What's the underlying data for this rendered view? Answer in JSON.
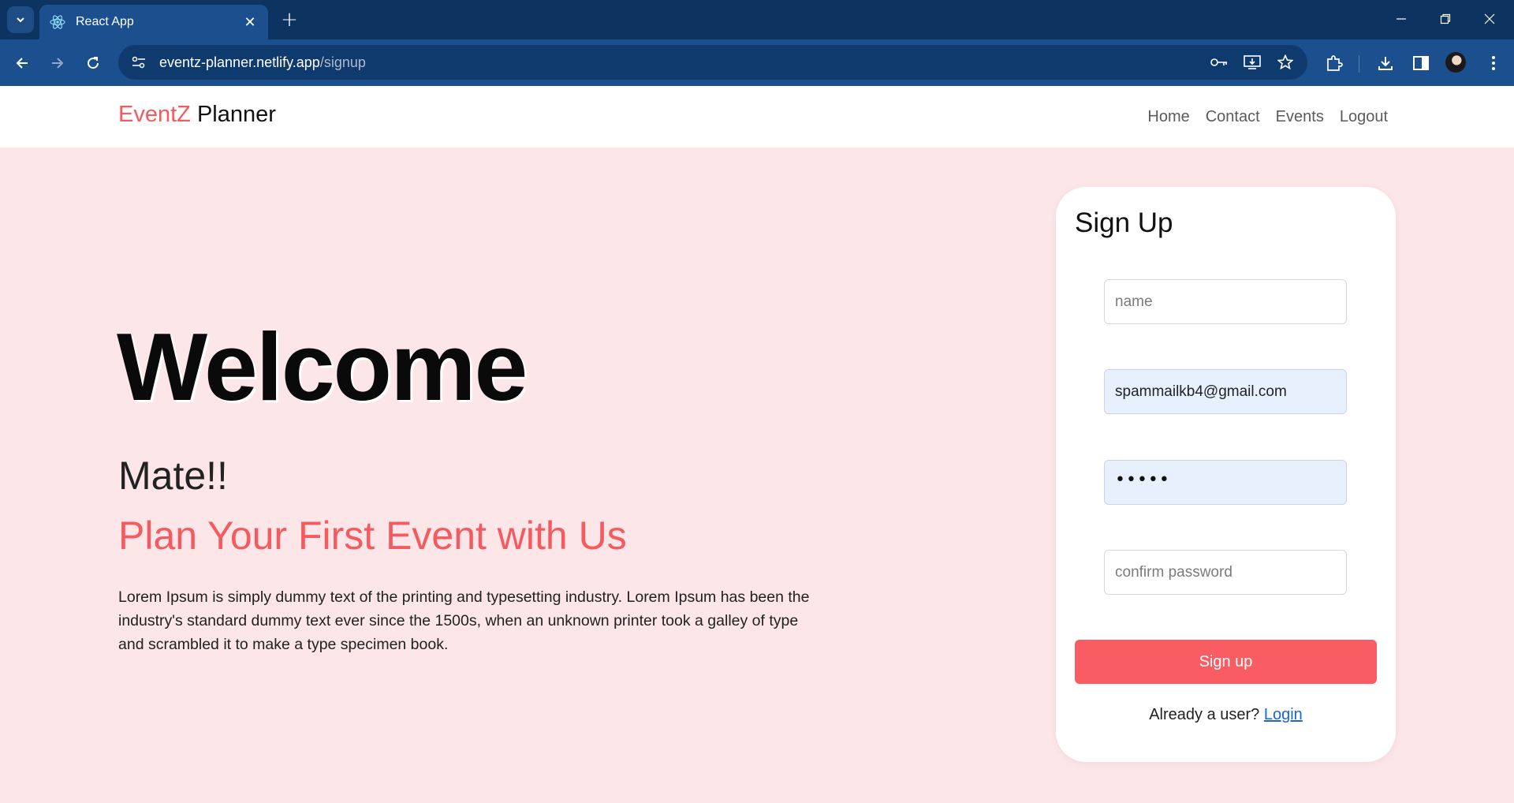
{
  "browser": {
    "tab_title": "React App",
    "url_host": "eventz-planner.netlify.app",
    "url_path": "/signup",
    "icons": [
      "tab-search-icon",
      "react-favicon-icon",
      "close-icon",
      "new-tab-icon",
      "minimize-icon",
      "maximize-icon",
      "window-close-icon",
      "back-icon",
      "forward-icon",
      "reload-icon",
      "site-info-icon",
      "password-key-icon",
      "install-app-icon",
      "bookmark-star-icon",
      "extensions-icon",
      "downloads-icon",
      "side-panel-icon",
      "profile-avatar",
      "menu-icon"
    ]
  },
  "navbar": {
    "brand_part1": "EventZ",
    "brand_part2": "Planner",
    "links": [
      "Home",
      "Contact",
      "Events",
      "Logout"
    ]
  },
  "hero": {
    "title": "Welcome",
    "subtitle": "Mate!!",
    "tagline": "Plan Your First Event with Us",
    "body": "Lorem Ipsum is simply dummy text of the printing and typesetting industry. Lorem Ipsum has been the industry's standard dummy text ever since the 1500s, when an unknown printer took a galley of type and scrambled it to make a type specimen book."
  },
  "signup": {
    "title": "Sign Up",
    "name_placeholder": "name",
    "email_value": "spammailkb4@gmail.com",
    "password_mask": "•••••",
    "confirm_placeholder": "confirm password",
    "button": "Sign up",
    "already_text": "Already a user?",
    "login_link": "Login"
  },
  "colors": {
    "accent": "#f45a5f",
    "button": "#fa5c63",
    "page_bg": "#fde6e7",
    "chrome_dark": "#0d3461",
    "chrome": "#1b4f8e"
  }
}
